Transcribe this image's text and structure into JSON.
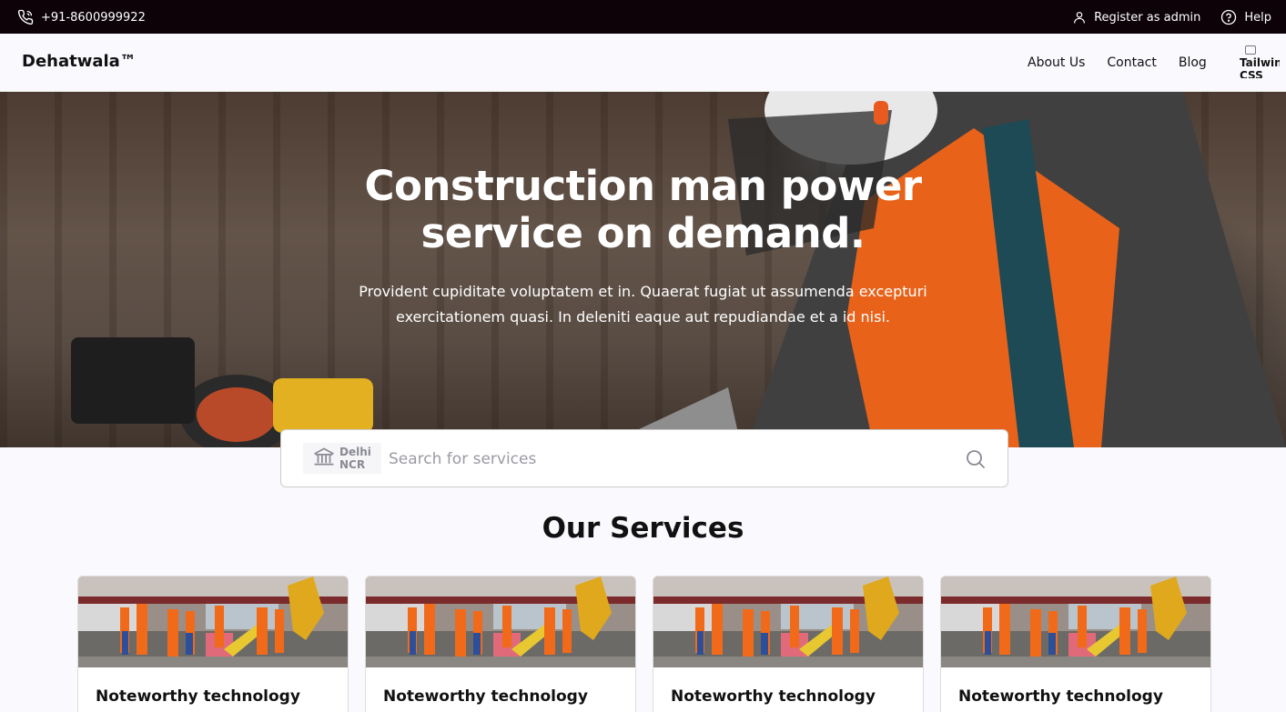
{
  "topbar": {
    "phone": "+91-8600999922",
    "phone_icon": "phone-icon",
    "register": "Register as admin",
    "register_icon": "user-icon",
    "help": "Help",
    "help_icon": "help-circle-icon"
  },
  "nav": {
    "brand": "Dehatwala™",
    "links": [
      "About Us",
      "Contact",
      "Blog"
    ],
    "avatar_alt": "Tailwind CSS"
  },
  "hero": {
    "title": "Construction man power service on demand.",
    "subtitle": "Provident cupiditate voluptatem et in. Quaerat fugiat ut assumenda excepturi exercitationem quasi. In deleniti eaque aut repudiandae et a id nisi."
  },
  "search": {
    "location": "Delhi NCR",
    "location_icon": "bank-building-icon",
    "placeholder": "Search for services",
    "icon": "search-icon"
  },
  "services": {
    "title": "Our Services",
    "cards": [
      {
        "title": "Noteworthy technology"
      },
      {
        "title": "Noteworthy technology"
      },
      {
        "title": "Noteworthy technology"
      },
      {
        "title": "Noteworthy technology"
      }
    ]
  },
  "colors": {
    "topbar_bg": "#0c0208",
    "page_bg": "#fafafe",
    "worker_orange": "#f06a1a"
  }
}
